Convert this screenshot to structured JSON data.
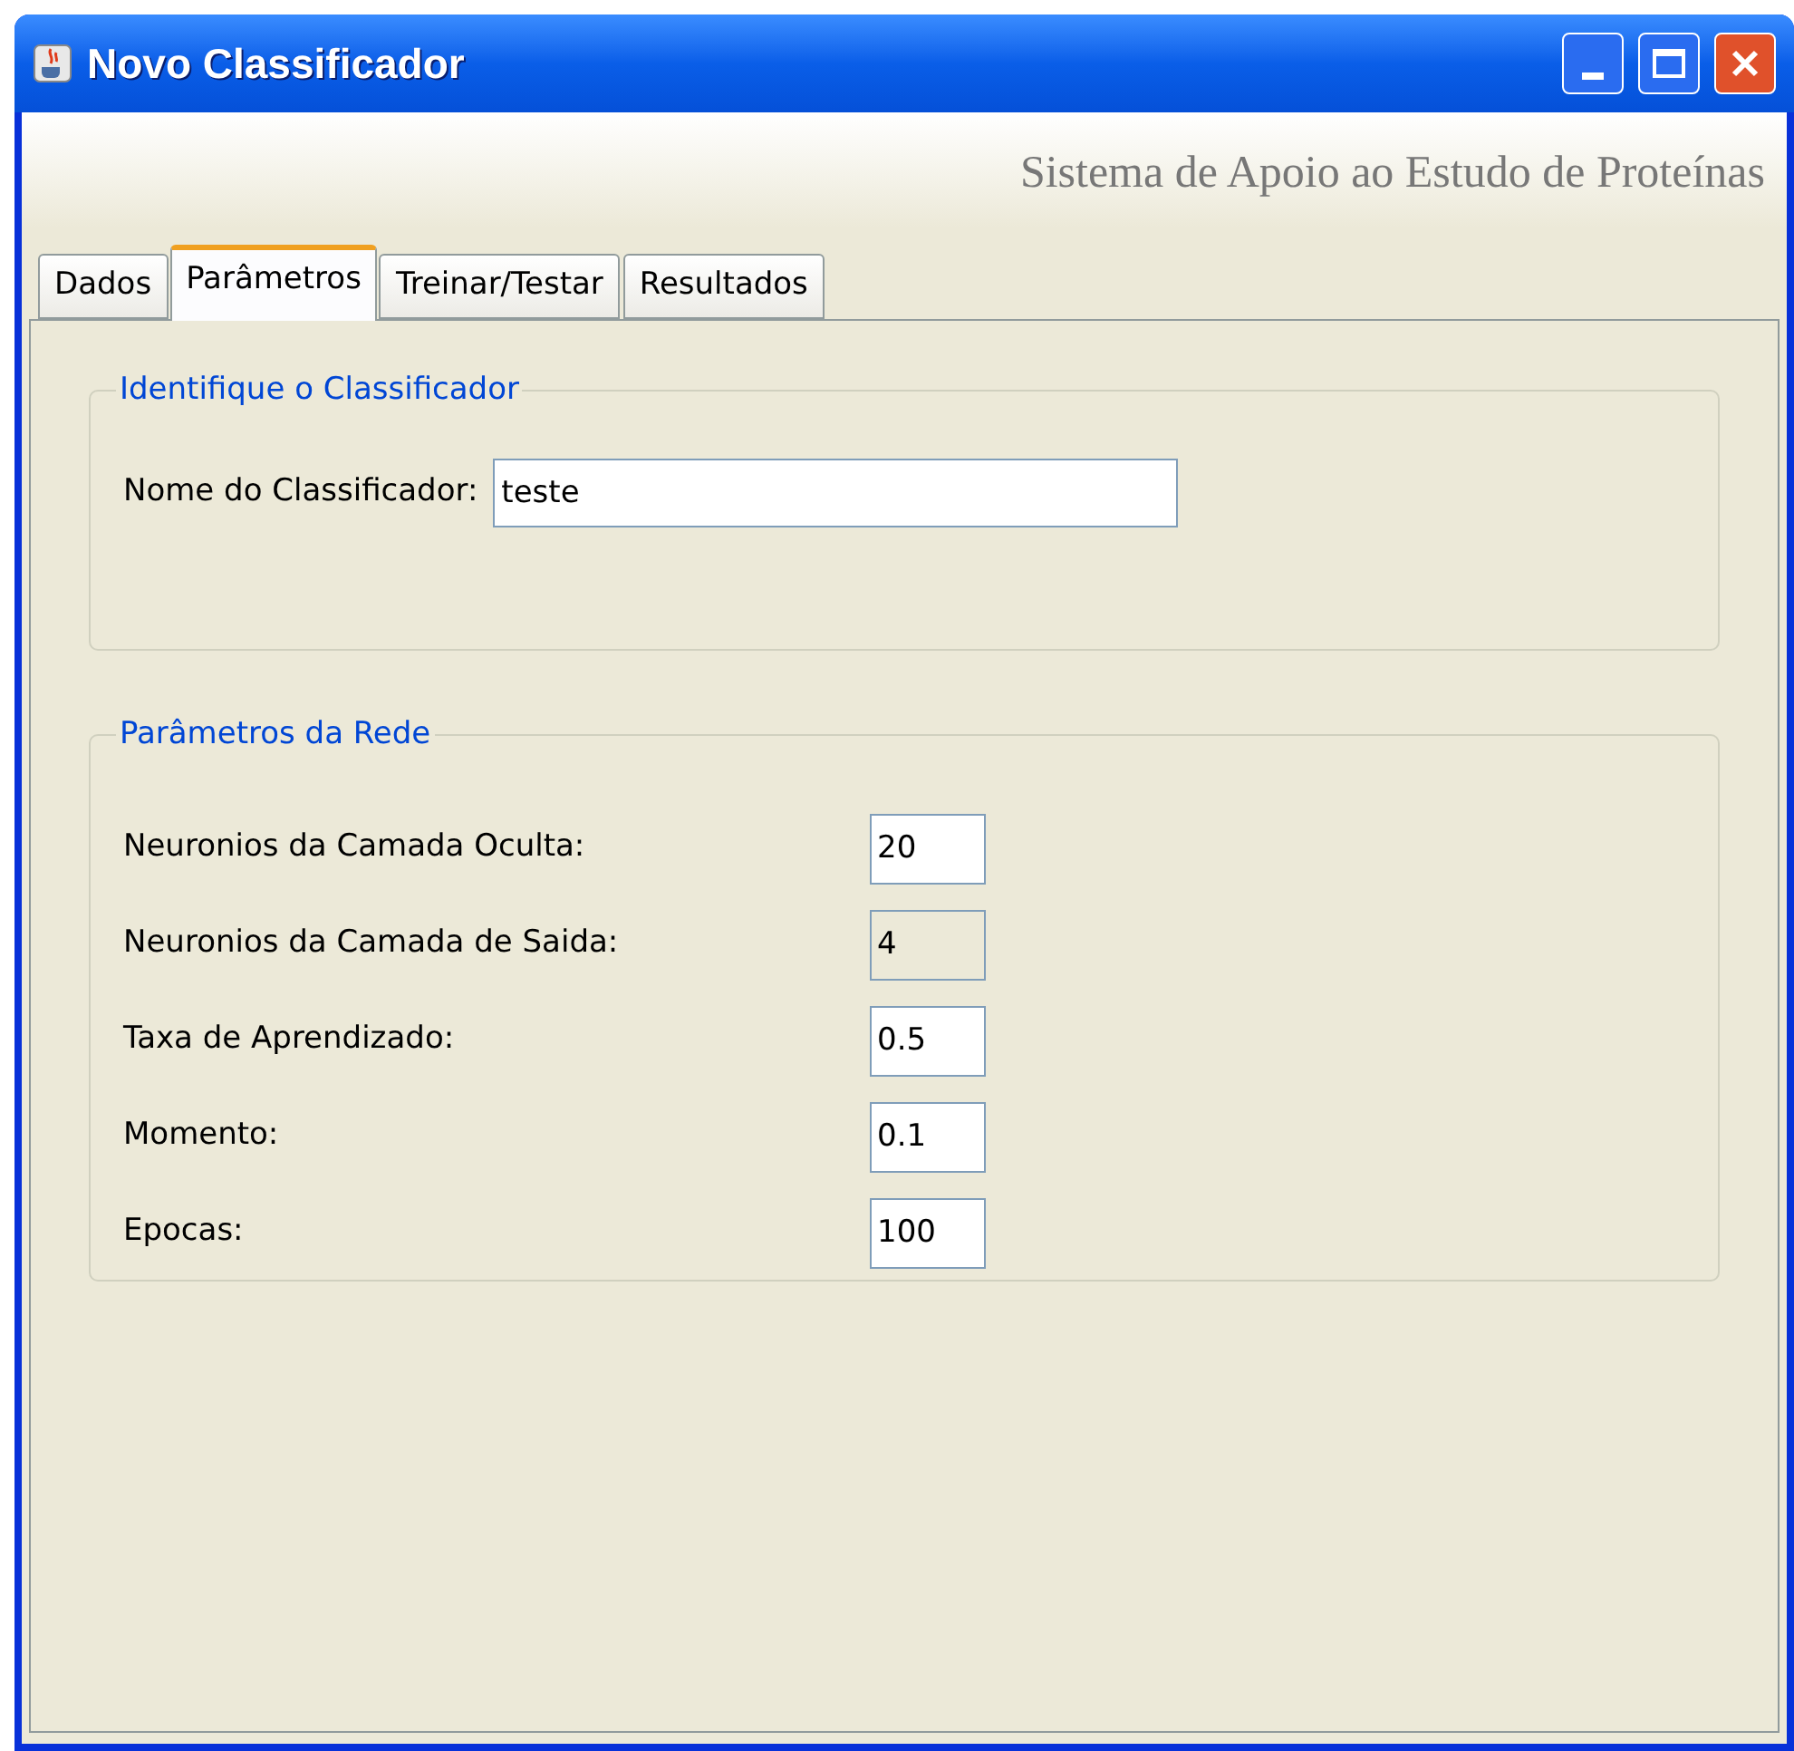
{
  "window": {
    "title": "Novo Classificador"
  },
  "header": "Sistema de Apoio ao Estudo de Proteínas",
  "tabs": [
    {
      "label": "Dados",
      "selected": false
    },
    {
      "label": "Parâmetros",
      "selected": true
    },
    {
      "label": "Treinar/Testar",
      "selected": false
    },
    {
      "label": "Resultados",
      "selected": false
    }
  ],
  "identify_group": {
    "title": "Identifique o Classificador",
    "label": "Nome do Classificador:",
    "value": "teste"
  },
  "network_group": {
    "title": "Parâmetros da Rede",
    "fields": [
      {
        "label": "Neuronios da Camada Oculta:",
        "value": "20",
        "disabled": false
      },
      {
        "label": "Neuronios da Camada de Saida:",
        "value": "4",
        "disabled": true
      },
      {
        "label": "Taxa de Aprendizado:",
        "value": "0.5",
        "disabled": false
      },
      {
        "label": "Momento:",
        "value": "0.1",
        "disabled": false
      },
      {
        "label": "Epocas:",
        "value": "100",
        "disabled": false
      }
    ]
  }
}
